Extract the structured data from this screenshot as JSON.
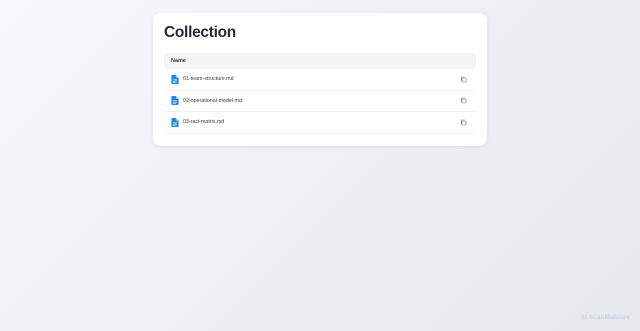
{
  "page": {
    "title": "Collection"
  },
  "table": {
    "header": "Name",
    "rows": [
      {
        "name": "01-team-structure.md",
        "icon": "document-icon"
      },
      {
        "name": "02-operational-model.md",
        "icon": "document-icon"
      },
      {
        "name": "03-raci-matrix.md",
        "icon": "document-icon"
      }
    ]
  },
  "watermark": {
    "text": "ScanMalware"
  },
  "colors": {
    "accent": "#1e88e5",
    "muted": "#9aa0a6",
    "watermark": "#c7d3ea"
  }
}
